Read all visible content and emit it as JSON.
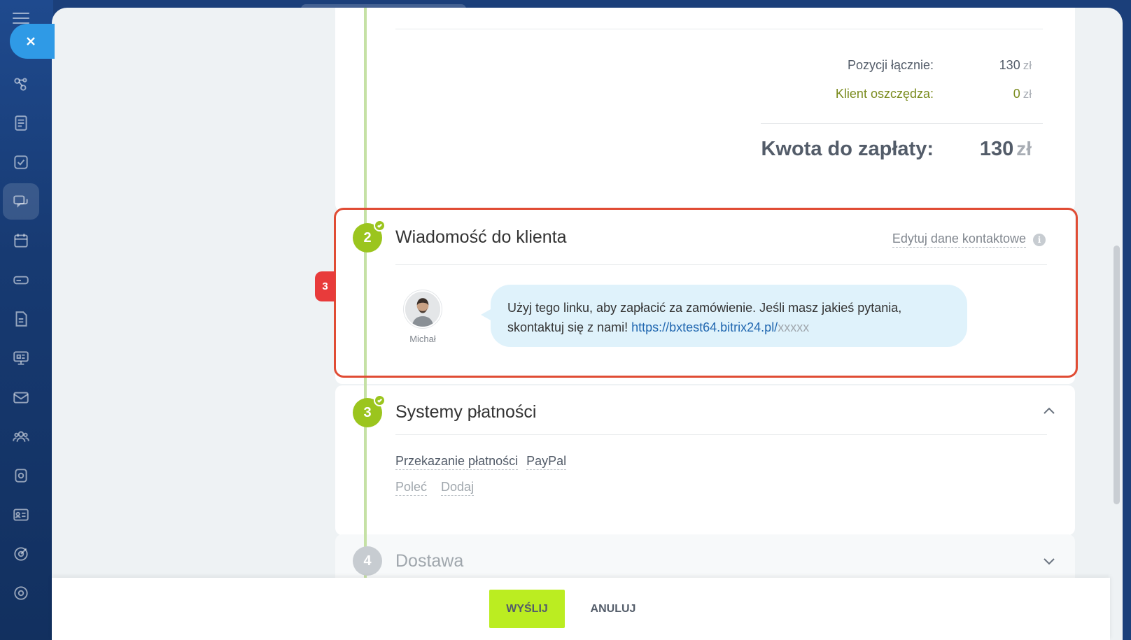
{
  "totals": {
    "positions_label": "Pozycji łącznie:",
    "positions_value": "130",
    "positions_currency": "zł",
    "savings_label": "Klient oszczędza:",
    "savings_value": "0",
    "savings_currency": "zł",
    "total_label": "Kwota do zapłaty:",
    "total_value": "130",
    "total_currency": "zł"
  },
  "message_section": {
    "step_number": "2",
    "title": "Wiadomość do klienta",
    "edit_contacts": "Edytuj dane kontaktowe",
    "sender_name": "Michał",
    "message_text": "Użyj tego linku, aby zapłacić za zamówienie. Jeśli masz jakieś pytania, skontaktuj się z nami! ",
    "link_text": "https://bxtest64.bitrix24.pl/",
    "link_mask": "xxxxx"
  },
  "annotation": {
    "badge": "3"
  },
  "payment_section": {
    "step_number": "3",
    "title": "Systemy płatności",
    "transfer_label": "Przekazanie płatności",
    "provider": "PayPal",
    "recommend": "Poleć",
    "add": "Dodaj"
  },
  "delivery_section": {
    "step_number": "4",
    "title": "Dostawa"
  },
  "footer": {
    "send_label": "WYŚLIJ",
    "cancel_label": "ANULUJ"
  },
  "colors": {
    "accent_green": "#9bc51e",
    "send_button": "#bbed21",
    "highlight_red": "#e04c34",
    "bubble_blue": "#dff2fb"
  }
}
